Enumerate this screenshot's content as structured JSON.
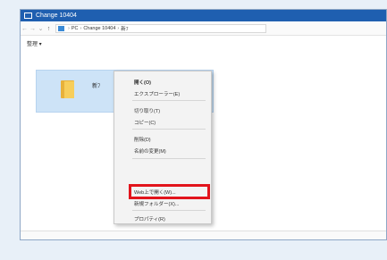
{
  "window": {
    "title": "Change 10404",
    "address": {
      "crumbs": [
        "PC",
        "Change 10404",
        "新ﾌ"
      ],
      "separator": "›"
    },
    "toolbar_label": "整理 ▾"
  },
  "folder": {
    "label": "新ﾌ"
  },
  "context_menu": {
    "items": [
      {
        "label": "開く(O)"
      },
      {
        "label": "エクスプローラー(E)"
      },
      {
        "label": "切り取り(T)"
      },
      {
        "label": "コピー(C)"
      },
      {
        "label": "削除(D)"
      },
      {
        "label": "名前の変更(M)"
      },
      {
        "label": "Web上で開く(W)..."
      },
      {
        "label": "新規フォルダー(X)..."
      },
      {
        "label": "プロパティ(R)"
      }
    ],
    "highlighted_index": 6
  },
  "colors": {
    "titlebar": "#1f5fb0",
    "highlight": "#e2141c",
    "selection": "#cde3f7"
  }
}
